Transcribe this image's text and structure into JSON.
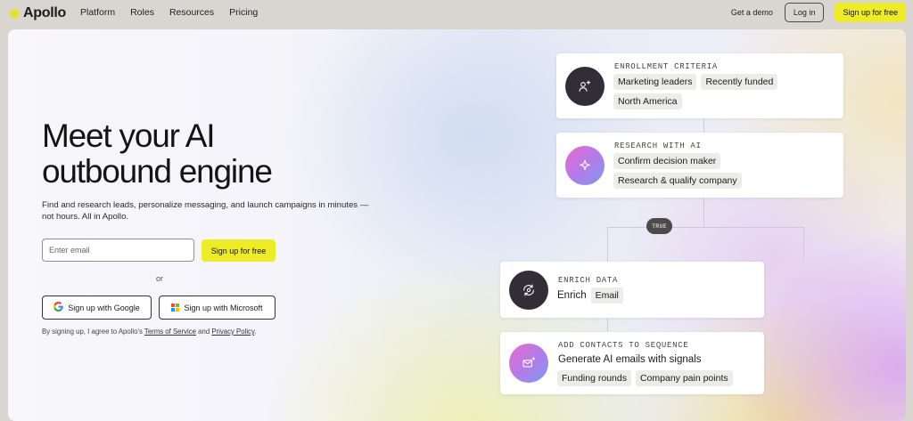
{
  "nav": {
    "logo_text": "Apollo",
    "links": [
      "Platform",
      "Roles",
      "Resources",
      "Pricing"
    ],
    "demo_label": "Get a demo",
    "login_label": "Log in",
    "signup_label": "Sign up for free"
  },
  "hero": {
    "headline_line1": "Meet your AI",
    "headline_line2": "outbound engine",
    "subtext": "Find and research leads, personalize messaging, and launch campaigns in minutes — not hours. All in Apollo.",
    "email_placeholder": "Enter email",
    "signup_label": "Sign up for free",
    "or_label": "or",
    "google_label": "Sign up with Google",
    "microsoft_label": "Sign up with Microsoft",
    "terms_prefix": "By signing up, I agree to Apollo's ",
    "terms_link": "Terms of Service",
    "terms_and": " and ",
    "privacy_link": "Privacy Policy",
    "terms_suffix": "."
  },
  "flow": {
    "true_label": "TRUE",
    "enrollment": {
      "label": "ENROLLMENT CRITERIA",
      "tags": [
        "Marketing leaders",
        "Recently funded",
        "North America"
      ]
    },
    "research": {
      "label": "RESEARCH WITH AI",
      "tags": [
        "Confirm decision maker",
        "Research & qualify company"
      ]
    },
    "enrich": {
      "label": "ENRICH DATA",
      "text": "Enrich",
      "tag": "Email"
    },
    "contacts": {
      "label": "ADD CONTACTS TO SEQUENCE",
      "text": "Generate AI emails with signals",
      "tags": [
        "Funding rounds",
        "Company pain points"
      ]
    }
  },
  "colors": {
    "accent_yellow": "#eeeb27",
    "icon_dark": "#332d38",
    "brand_logo": "#e6e31b"
  },
  "icons": [
    "apollo-logo-icon",
    "google-icon",
    "microsoft-icon",
    "person-sparkle-icon",
    "sparkle-icon",
    "refresh-enrich-icon",
    "mail-sparkle-icon"
  ]
}
